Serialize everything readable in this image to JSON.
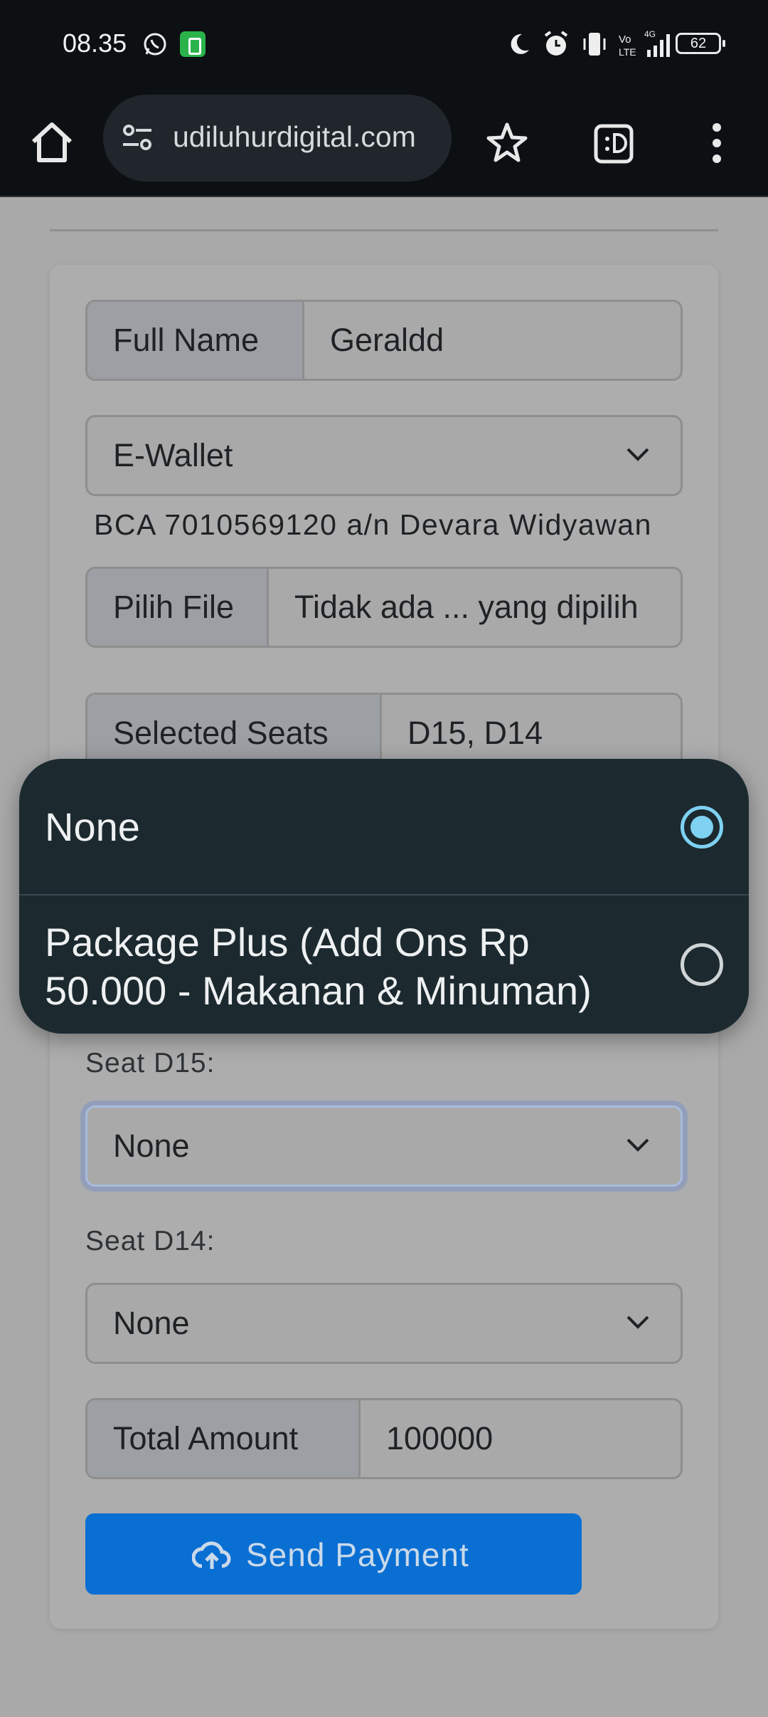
{
  "status_bar": {
    "time": "08.35",
    "battery": "62",
    "network": "4G"
  },
  "browser": {
    "url": "udiluhurdigital.com"
  },
  "form": {
    "full_name_label": "Full Name",
    "full_name_value": "Geraldd",
    "payment_method": "E-Wallet",
    "bank_info": "BCA 7010569120 a/n Devara Widyawan",
    "file_button": "Pilih File",
    "file_status": "Tidak ada ... yang dipilih",
    "selected_seats_label": "Selected Seats",
    "selected_seats_value": "D15, D14",
    "seats": [
      {
        "label": "Seat D15:",
        "value": "None"
      },
      {
        "label": "Seat D14:",
        "value": "None"
      }
    ],
    "total_label": "Total Amount",
    "total_value": "100000",
    "submit_label": "Send Payment"
  },
  "popup": {
    "options": [
      {
        "label": "None",
        "selected": true
      },
      {
        "label": "Package Plus (Add Ons Rp 50.000 - Makanan & Minuman)",
        "selected": false
      }
    ]
  },
  "colors": {
    "accent": "#0a6fd3",
    "radio_selected": "#7ed1f1",
    "popup_bg": "#1c2a30"
  }
}
